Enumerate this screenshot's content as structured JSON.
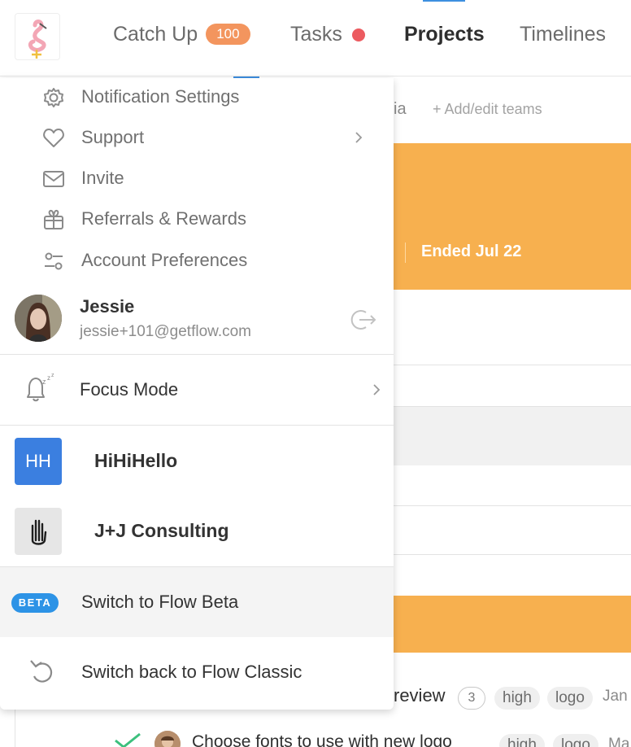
{
  "nav": {
    "items": [
      {
        "label": "Catch Up",
        "badge": "100"
      },
      {
        "label": "Tasks",
        "indicator": "red-dot"
      },
      {
        "label": "Projects",
        "active": true
      },
      {
        "label": "Timelines"
      }
    ]
  },
  "background": {
    "team_tail": "ia",
    "add_teams": "+ Add/edit teams",
    "project_status": "Ended Jul 22",
    "task_title_tail": "review",
    "comment_count": "3",
    "tags": [
      "high",
      "logo"
    ],
    "date_tail": "Jan",
    "task2_title": "Choose fonts to use with new logo",
    "task2_tags": [
      "high",
      "logo"
    ],
    "task2_date_tail": "Ma"
  },
  "menu": {
    "items": [
      {
        "label": "Notification Settings",
        "icon": "gear-icon"
      },
      {
        "label": "Support",
        "icon": "heart-icon",
        "has_submenu": true
      },
      {
        "label": "Invite",
        "icon": "envelope-icon"
      },
      {
        "label": "Referrals & Rewards",
        "icon": "gift-icon"
      },
      {
        "label": "Account Preferences",
        "icon": "sliders-icon"
      }
    ],
    "user": {
      "name": "Jessie",
      "email": "jessie+101@getflow.com"
    },
    "focus_mode": "Focus Mode",
    "orgs": [
      {
        "initials": "HH",
        "name": "HiHiHello",
        "tile_color": "#3b7fe0"
      },
      {
        "name": "J+J Consulting",
        "icon": "hand-icon",
        "tile_color": "#e6e6e6"
      }
    ],
    "beta_badge": "BETA",
    "beta_label": "Switch to Flow Beta",
    "classic_label": "Switch back to Flow Classic"
  },
  "colors": {
    "accent_orange": "#f7b04f",
    "badge_orange": "#f3955e",
    "beta_blue": "#2d93e6",
    "dot_red": "#ec5b60"
  }
}
